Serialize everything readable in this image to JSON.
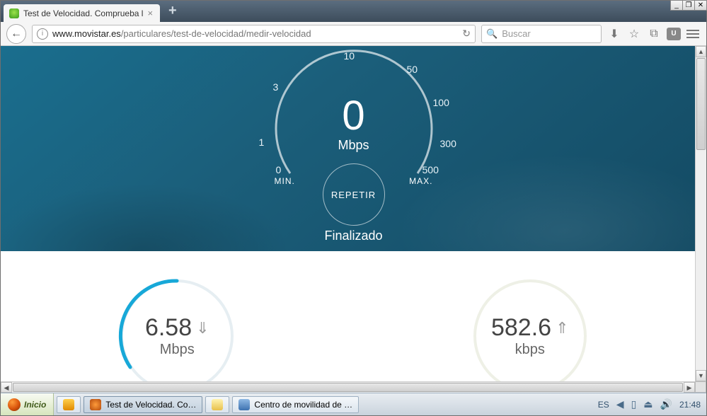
{
  "window_controls": {
    "min": "_",
    "restore": "❐",
    "close": "✕"
  },
  "tab": {
    "title": "Test de Velocidad. Comprueba l",
    "close": "×",
    "new": "+"
  },
  "nav": {
    "url_host": "www.movistar.es",
    "url_path": "/particulares/test-de-velocidad/medir-velocidad",
    "search_placeholder": "Buscar"
  },
  "gauge": {
    "value": "0",
    "unit": "Mbps",
    "ticks": {
      "t0": "0",
      "t1": "1",
      "t3": "3",
      "t10": "10",
      "t50": "50",
      "t100": "100",
      "t300": "300",
      "t500": "500"
    },
    "min": "MIN.",
    "max": "MAX.",
    "repeat": "REPETIR",
    "status": "Finalizado"
  },
  "download": {
    "value": "6.58",
    "unit": "Mbps",
    "arrow": "⇓"
  },
  "upload": {
    "value": "582.6",
    "unit": "kbps",
    "arrow": "⇑"
  },
  "taskbar": {
    "start": "Inicio",
    "items": [
      "Test de Velocidad. Co…",
      "Centro de movilidad de …"
    ],
    "lang": "ES",
    "clock": "21:48"
  }
}
